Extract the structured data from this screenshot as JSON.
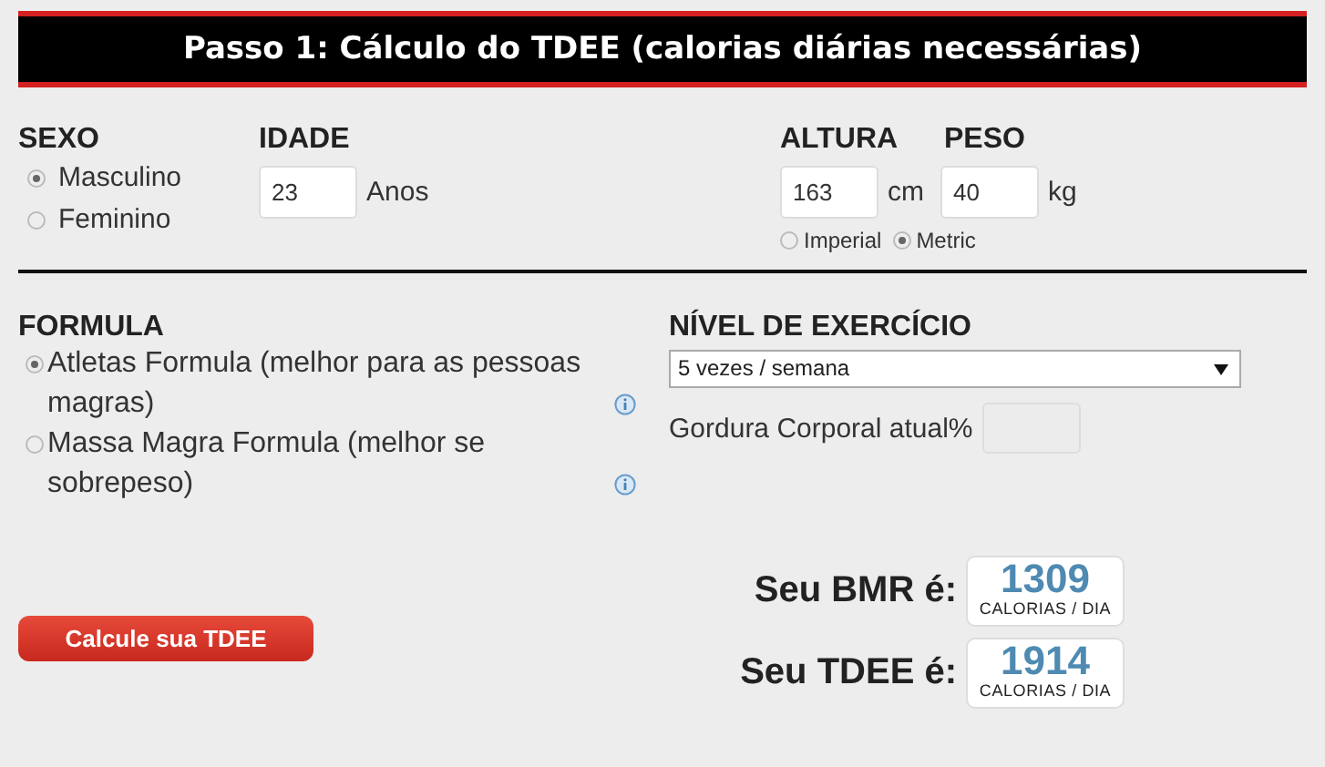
{
  "title": "Passo 1: Cálculo do TDEE (calorias diárias necessárias)",
  "sexo": {
    "label": "SEXO",
    "options": [
      {
        "label": "Masculino",
        "selected": true
      },
      {
        "label": "Feminino",
        "selected": false
      }
    ]
  },
  "idade": {
    "label": "IDADE",
    "value": "23",
    "unit": "Anos"
  },
  "altura": {
    "label": "ALTURA",
    "value": "163",
    "unit": "cm"
  },
  "peso": {
    "label": "PESO",
    "value": "40",
    "unit": "kg"
  },
  "units": [
    {
      "label": "Imperial",
      "selected": false
    },
    {
      "label": "Metric",
      "selected": true
    }
  ],
  "formula": {
    "label": "FORMULA",
    "options": [
      {
        "label": "Atletas Formula (melhor para as pessoas magras)",
        "selected": true
      },
      {
        "label": "Massa Magra Formula (melhor se sobrepeso)",
        "selected": false
      }
    ]
  },
  "exercicio": {
    "label": "NÍVEL DE EXERCÍCIO",
    "value": "5 vezes / semana"
  },
  "gordura": {
    "label": "Gordura Corporal atual%"
  },
  "button": "Calcule sua TDEE",
  "results": [
    {
      "label": "Seu BMR é:",
      "value": "1309",
      "unit": "CALORIAS / DIA"
    },
    {
      "label": "Seu TDEE é:",
      "value": "1914",
      "unit": "CALORIAS / DIA"
    }
  ]
}
